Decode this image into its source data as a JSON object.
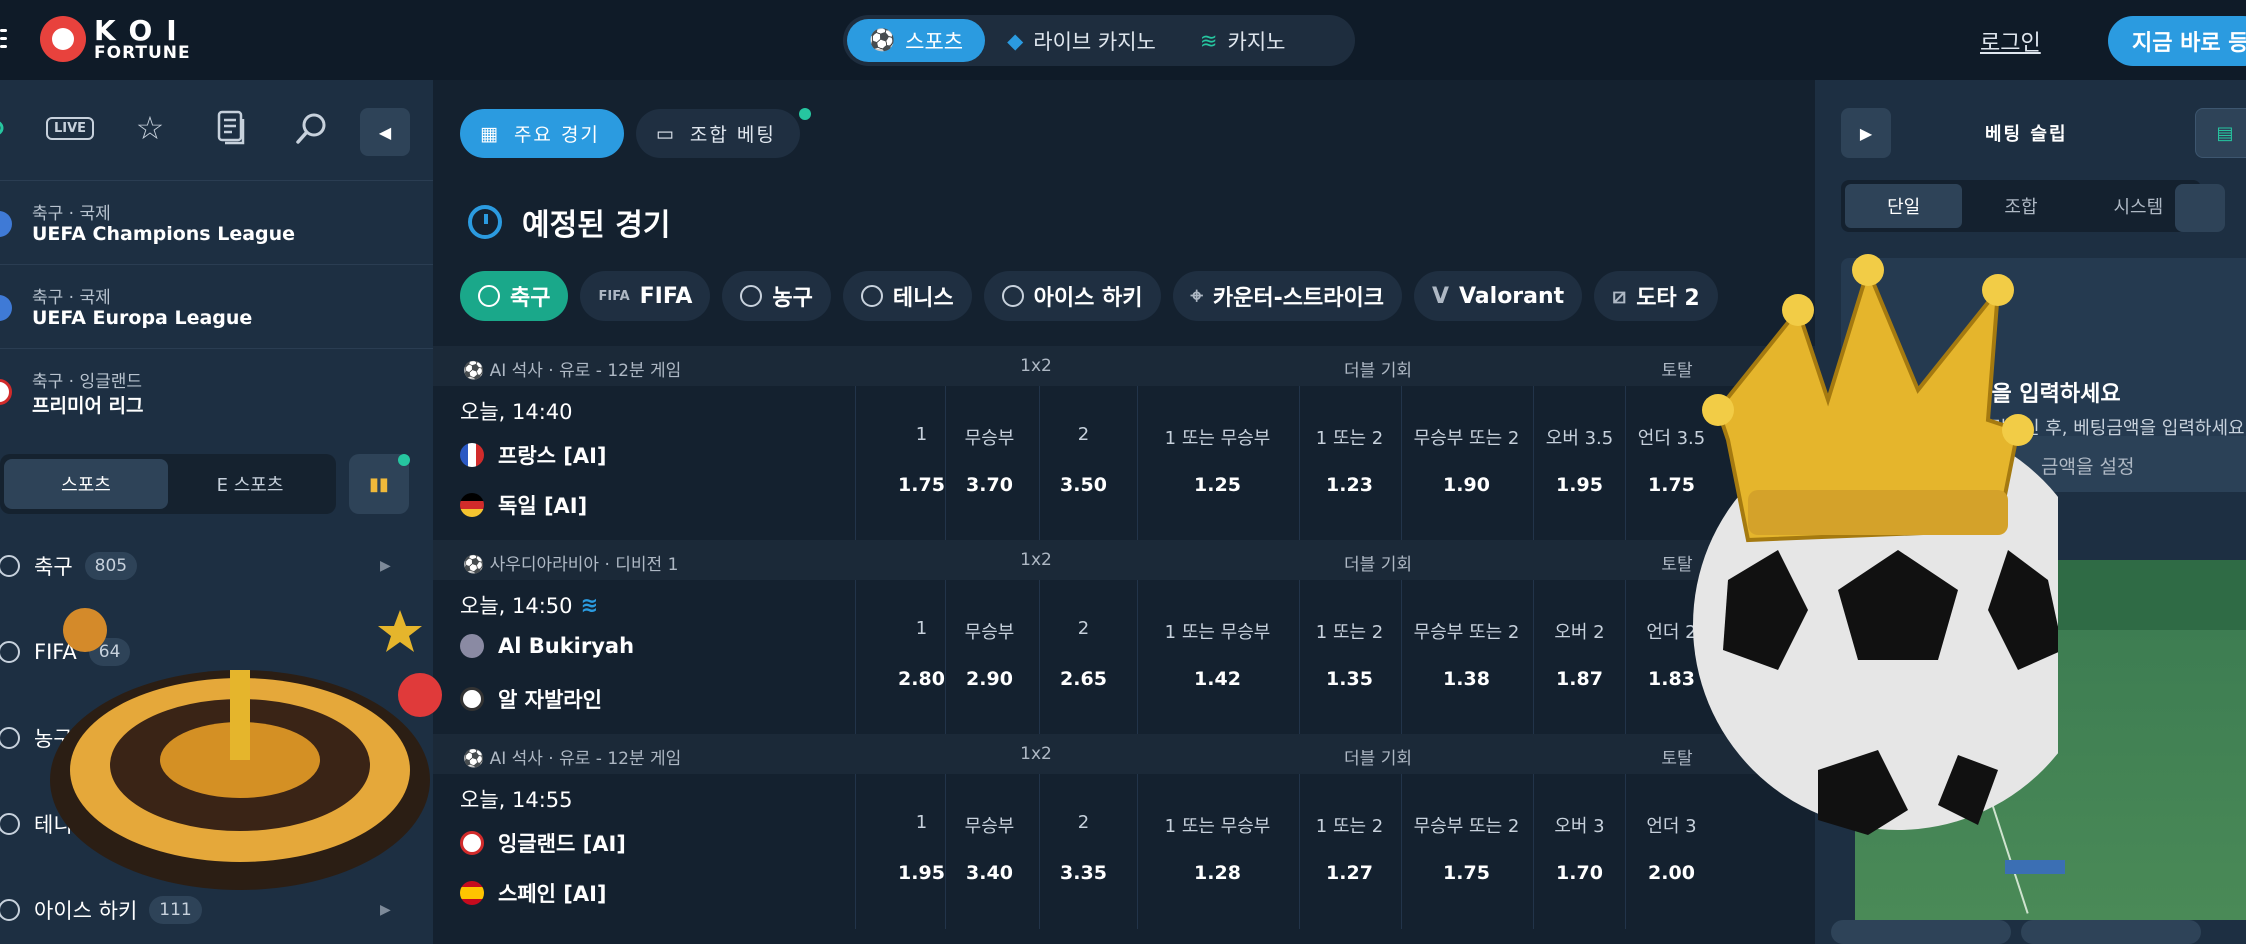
{
  "brand": {
    "line1": "KOI",
    "line2": "FORTUNE"
  },
  "topnav": {
    "items": [
      {
        "label": "스포츠",
        "icon": "soccer-ball-icon",
        "active": true
      },
      {
        "label": "라이브 카지노",
        "icon": "live-casino-icon",
        "active": false
      },
      {
        "label": "카지노",
        "icon": "casino-icon",
        "active": false
      }
    ],
    "login": "로그인",
    "join": "지금 바로 등"
  },
  "left": {
    "icons": [
      "live-icon",
      "star-icon",
      "betslip-history-icon",
      "search-icon"
    ],
    "live_label": "LIVE",
    "leagues": [
      {
        "sub": "축구 · 국제",
        "name": "UEFA Champions League"
      },
      {
        "sub": "축구 · 국제",
        "name": "UEFA Europa League"
      },
      {
        "sub": "축구 · 잉글랜드",
        "name": "프리미어 리그"
      }
    ],
    "toggle": [
      "스포츠",
      "E 스포츠"
    ],
    "sports": [
      {
        "name": "축구",
        "count": "805"
      },
      {
        "name": "FIFA",
        "count": "64"
      },
      {
        "name": "농구",
        "count": ""
      },
      {
        "name": "테니스",
        "count": ""
      },
      {
        "name": "아이스 하키",
        "count": "111"
      }
    ]
  },
  "main": {
    "tabs": [
      "주요 경기",
      "조합 베팅"
    ],
    "section_title": "예정된 경기",
    "chips": [
      "축구",
      "FIFA",
      "농구",
      "테니스",
      "아이스 하키",
      "카운터-스트라이크",
      "Valorant",
      "도타 2"
    ],
    "matches": [
      {
        "league": "AI 석사 · 유로 - 12분 게임",
        "time": "오늘, 14:40",
        "home": "프랑스 [AI]",
        "away": "독일 [AI]",
        "groups": [
          "1x2",
          "더블 기회",
          "토탈"
        ],
        "labels": [
          "1",
          "무승부",
          "2",
          "1 또는 무승부",
          "1 또는 2",
          "무승부 또는 2",
          "오버 3.5",
          "언더 3.5"
        ],
        "odds": [
          "1.75",
          "3.70",
          "3.50",
          "1.25",
          "1.23",
          "1.90",
          "1.95",
          "1.75"
        ]
      },
      {
        "league": "사우디아라비아 · 디비전 1",
        "time": "오늘, 14:50",
        "home": "Al Bukiryah",
        "away": "알 자발라인",
        "groups": [
          "1x2",
          "더블 기회",
          "토탈"
        ],
        "labels": [
          "1",
          "무승부",
          "2",
          "1 또는 무승부",
          "1 또는 2",
          "무승부 또는 2",
          "오버 2",
          "언더 2"
        ],
        "odds": [
          "2.80",
          "2.90",
          "2.65",
          "1.42",
          "1.35",
          "1.38",
          "1.87",
          "1.83"
        ]
      },
      {
        "league": "AI 석사 · 유로 - 12분 게임",
        "time": "오늘, 14:55",
        "home": "잉글랜드 [AI]",
        "away": "스페인 [AI]",
        "groups": [
          "1x2",
          "더블 기회",
          "토탈"
        ],
        "labels": [
          "1",
          "무승부",
          "2",
          "1 또는 무승부",
          "1 또는 2",
          "무승부 또는 2",
          "오버 3",
          "언더 3"
        ],
        "odds": [
          "1.95",
          "3.40",
          "3.35",
          "1.28",
          "1.27",
          "1.75",
          "1.70",
          "2.00"
        ]
      }
    ]
  },
  "betslip": {
    "title": "베팅 슬립",
    "tabs": [
      "단일",
      "조합",
      "시스템"
    ],
    "heading": "금액을 입력하세요",
    "desc": "을 클릭하신 후, 베팅금액을 입력하세요.",
    "amount": "금액을 설정"
  },
  "colors": {
    "accent": "#2b9be0",
    "green": "#1aa88a",
    "bg": "#0f1b28",
    "panel": "#1d2f42"
  }
}
